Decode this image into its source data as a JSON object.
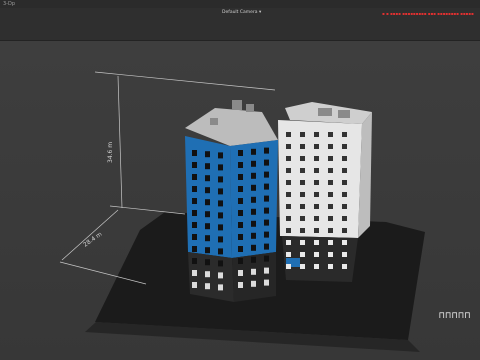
{
  "titlebar": {
    "title": "3-Dp"
  },
  "toolbar": {
    "camera_label": "Default Camera ▾",
    "status_message": "▪ ▪ ▪▪▪▪ ▪▪▪▪▪▪▪▪▪ ▪▪▪ ▪▪▪▪▪▪▪▪ ▪▪▪▪▪"
  },
  "viewport": {
    "height_dimension": "34.6 m",
    "width_dimension": "28.4 m",
    "corner_glyphs": "⊓⊓⊓⊓⊓",
    "colors": {
      "background": "#3a3a3a",
      "facade_blue": "#1f6fb4",
      "facade_white": "#e7e7e7",
      "ground_plane": "#1c1c1c",
      "status_red": "#e23030"
    }
  }
}
